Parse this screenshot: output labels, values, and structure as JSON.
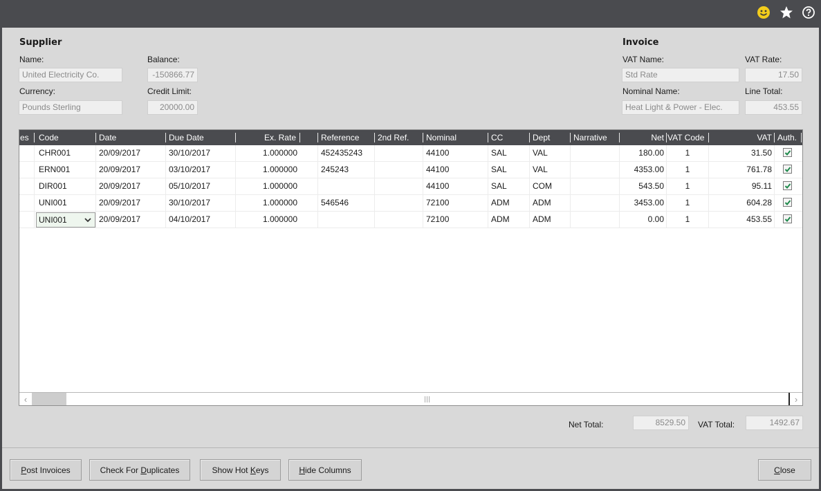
{
  "titlebar": {
    "icons": [
      "smiley-feedback-icon",
      "star-favourite-icon",
      "help-icon"
    ],
    "accent_color": "#f2cc1c"
  },
  "supplier": {
    "section_title": "Supplier",
    "name_label": "Name:",
    "name_value": "United Electricity Co.",
    "balance_label": "Balance:",
    "balance_value": "-150866.77",
    "currency_label": "Currency:",
    "currency_value": "Pounds Sterling",
    "credit_limit_label": "Credit Limit:",
    "credit_limit_value": "20000.00"
  },
  "invoice": {
    "section_title": "Invoice",
    "vat_name_label": "VAT Name:",
    "vat_name_value": "Std Rate",
    "vat_rate_label": "VAT Rate:",
    "vat_rate_value": "17.50",
    "nominal_name_label": "Nominal Name:",
    "nominal_name_value": "Heat Light & Power - Elec.",
    "line_total_label": "Line Total:",
    "line_total_value": "453.55"
  },
  "grid": {
    "columns": [
      "es",
      "Code",
      "Date",
      "Due Date",
      "Ex. Rate",
      "",
      "Reference",
      "2nd Ref.",
      "Nominal",
      "CC",
      "Dept",
      "Narrative",
      "Net",
      "VAT Code",
      "VAT",
      "Auth."
    ],
    "rows": [
      {
        "code": "CHR001",
        "date": "20/09/2017",
        "due_date": "30/10/2017",
        "ex_rate": "1.000000",
        "reference": "452435243",
        "ref2": "",
        "nominal": "44100",
        "cc": "SAL",
        "dept": "VAL",
        "narrative": "",
        "net": "180.00",
        "vat_code": "1",
        "vat": "31.50",
        "auth": true
      },
      {
        "code": "ERN001",
        "date": "20/09/2017",
        "due_date": "03/10/2017",
        "ex_rate": "1.000000",
        "reference": "245243",
        "ref2": "",
        "nominal": "44100",
        "cc": "SAL",
        "dept": "VAL",
        "narrative": "",
        "net": "4353.00",
        "vat_code": "1",
        "vat": "761.78",
        "auth": true
      },
      {
        "code": "DIR001",
        "date": "20/09/2017",
        "due_date": "05/10/2017",
        "ex_rate": "1.000000",
        "reference": "",
        "ref2": "",
        "nominal": "44100",
        "cc": "SAL",
        "dept": "COM",
        "narrative": "",
        "net": "543.50",
        "vat_code": "1",
        "vat": "95.11",
        "auth": true
      },
      {
        "code": "UNI001",
        "date": "20/09/2017",
        "due_date": "30/10/2017",
        "ex_rate": "1.000000",
        "reference": "546546",
        "ref2": "",
        "nominal": "72100",
        "cc": "ADM",
        "dept": "ADM",
        "narrative": "",
        "net": "3453.00",
        "vat_code": "1",
        "vat": "604.28",
        "auth": true
      },
      {
        "code": "UNI001",
        "date": "20/09/2017",
        "due_date": "04/10/2017",
        "ex_rate": "1.000000",
        "reference": "",
        "ref2": "",
        "nominal": "72100",
        "cc": "ADM",
        "dept": "ADM",
        "narrative": "",
        "net": "0.00",
        "vat_code": "1",
        "vat": "453.55",
        "auth": true,
        "editing": true
      }
    ]
  },
  "totals": {
    "net_total_label": "Net Total:",
    "net_total_value": "8529.50",
    "vat_total_label": "VAT Total:",
    "vat_total_value": "1492.67"
  },
  "buttons": {
    "post_invoices": {
      "accel": "P",
      "rest": "ost Invoices"
    },
    "check_duplicates": {
      "pre": "Check For ",
      "accel": "D",
      "rest": "uplicates"
    },
    "show_hot_keys": {
      "pre": "Show Hot ",
      "accel": "K",
      "rest": "eys"
    },
    "hide_columns": {
      "accel": "H",
      "rest": "ide Columns"
    },
    "close": {
      "accel": "C",
      "rest": "lose"
    }
  }
}
